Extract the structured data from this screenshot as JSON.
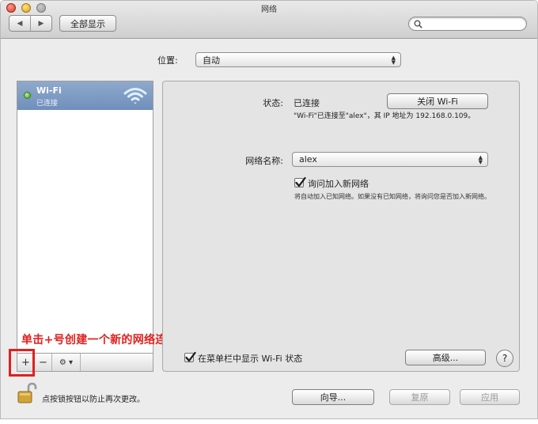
{
  "window": {
    "title": "网络",
    "show_all_label": "全部显示",
    "nav_back_glyph": "◀",
    "nav_forward_glyph": "▶"
  },
  "location": {
    "label": "位置:",
    "value": "自动"
  },
  "services": [
    {
      "name": "Wi-Fi",
      "status": "已连接",
      "status_color": "#3ea11f",
      "icon": "wifi-icon",
      "selected": true
    }
  ],
  "list_toolbar": {
    "add_label": "+",
    "remove_label": "−",
    "gear_label": "⚙ ▾"
  },
  "annotation": {
    "text": "单击+号创建一个新的网络连接",
    "color": "#e0201f"
  },
  "detail": {
    "status_label": "状态:",
    "status_value": "已连接",
    "turn_off_button": "关闭 Wi-Fi",
    "status_description": "\"Wi-Fi\"已连接至\"alex\"，其 IP 地址为 192.168.0.109。",
    "network_name_label": "网络名称:",
    "network_name_value": "alex",
    "ask_join_checked": true,
    "ask_join_label": "询问加入新网络",
    "ask_join_description": "将自动加入已知网络。如果没有已知网络，将询问您是否加入新网络。",
    "show_in_menu_checked": true,
    "show_in_menu_label": "在菜单栏中显示 Wi-Fi 状态",
    "advanced_button": "高级...",
    "help_button": "?"
  },
  "bottom": {
    "lock_text": "点按锁按钮以防止再次更改。",
    "assistant_button": "向导...",
    "revert_button": "复原",
    "apply_button": "应用"
  }
}
